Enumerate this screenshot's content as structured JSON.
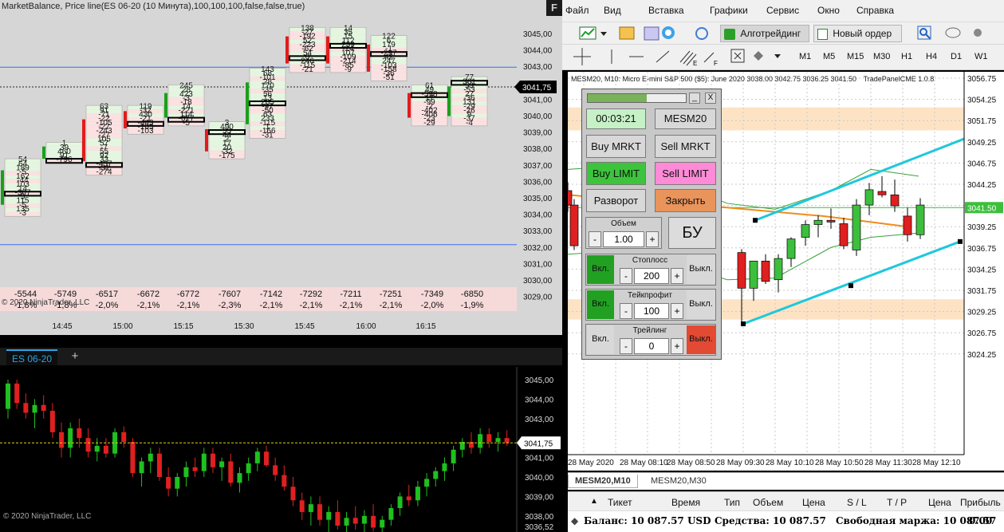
{
  "ninjatrader": {
    "chart_title": "MarketBalance, Price line(ES 06-20 (10 Минута),100,100,100,false,false,true)",
    "corner_label": "F",
    "copyright": "© 2020 NinjaTrader, LLC",
    "instrument_tab": "ES 06-20",
    "add_tab": "+",
    "price_axis_top": [
      "3045,00",
      "3044,00",
      "3043,00",
      "3042,00",
      "3041,00",
      "3040,00",
      "3039,00",
      "3038,00",
      "3037,00",
      "3036,00",
      "3035,00",
      "3034,00",
      "3033,00",
      "3032,00",
      "3031,00",
      "3030,00",
      "3029,00"
    ],
    "current_price": "3041,75",
    "time_labels": [
      "14:45",
      "15:00",
      "15:15",
      "15:30",
      "15:45",
      "16:00",
      "16:15"
    ],
    "deltas": [
      "-5544",
      "-5749",
      "-6517",
      "-6672",
      "-6772",
      "-7607",
      "-7142",
      "-7292",
      "-7211",
      "-7251",
      "-7349",
      "-6850"
    ],
    "delta_pct": [
      "-1,8%",
      "-1,8%",
      "-2,0%",
      "-2,1%",
      "-2,1%",
      "-2,3%",
      "-2,1%",
      "-2,1%",
      "-2,1%",
      "-2,1%",
      "-2,0%",
      "-1,9%"
    ],
    "price_axis_bottom": [
      "3045,00",
      "3044,00",
      "3043,00",
      "3042,00",
      "3041,00",
      "3040,00",
      "3039,00",
      "3038,00"
    ],
    "bottom_last_label": "3036,52"
  },
  "footprint_columns": [
    {
      "col": 0,
      "top_price": 3037.25,
      "values": [
        "54",
        "64",
        "189",
        "-5",
        "162",
        "-44",
        "103",
        "14",
        "-367",
        "5",
        "115",
        "-5",
        "135",
        "-3"
      ]
    },
    {
      "col": 1,
      "top_price": 3038.25,
      "values": [
        "1",
        "39",
        "460",
        "91",
        "-796"
      ]
    },
    {
      "col": 2,
      "top_price": 3040.5,
      "values": [
        "63",
        "91",
        "-71",
        "-22",
        "-105",
        "-27",
        "-243",
        "-27",
        "105",
        "57",
        "-7",
        "55",
        "92",
        "33",
        "-457",
        "-31",
        "-274"
      ]
    },
    {
      "col": 3,
      "top_price": 3040.5,
      "values": [
        "119",
        "-32",
        "430",
        "-21",
        "-443",
        "-105",
        "-103"
      ]
    },
    {
      "col": 4,
      "top_price": 3041.75,
      "values": [
        "245",
        "28",
        "423",
        "-3",
        "-18",
        "14",
        "-221",
        "114",
        "-677",
        "-5"
      ]
    },
    {
      "col": 5,
      "top_price": 3039.5,
      "values": [
        "3",
        "490",
        "53",
        "44",
        "2",
        "17",
        "20",
        "-32",
        "-175"
      ]
    },
    {
      "col": 6,
      "top_price": 3042.75,
      "values": [
        "143",
        "68",
        "-101",
        "28",
        "170",
        "-35",
        "56",
        "13",
        "285",
        "-97",
        "-50",
        "63",
        "233",
        "-115",
        "1",
        "-166",
        "-31"
      ]
    },
    {
      "col": 7,
      "top_price": 3045.25,
      "values": [
        "138",
        "-27",
        "-192",
        "52",
        "-223",
        "-62",
        "54",
        "0",
        "246",
        "-115",
        "-21"
      ]
    },
    {
      "col": 8,
      "top_price": 3045.25,
      "values": [
        "14",
        "35",
        "15",
        "112",
        "239",
        "-24",
        "107",
        "-109",
        "-214",
        "-85",
        "-9"
      ]
    },
    {
      "col": 9,
      "top_price": 3044.75,
      "values": [
        "122",
        "6",
        "179",
        "-1",
        "-297",
        "42",
        "247",
        "-103",
        "-158",
        "-36",
        "-51"
      ]
    },
    {
      "col": 10,
      "top_price": 3041.75,
      "values": [
        "61",
        "49",
        "-598",
        "17",
        "-99",
        "-2",
        "-402",
        "-406",
        "-23",
        "-29"
      ]
    },
    {
      "col": 11,
      "top_price": 3042.25,
      "values": [
        "77",
        "361",
        "53",
        "-53",
        "27",
        "-36",
        "131",
        "-29",
        "-26",
        "9",
        "-37",
        "-4"
      ]
    }
  ],
  "metatrader": {
    "menu": [
      "Файл",
      "Вид",
      "Вставка",
      "Графики",
      "Сервис",
      "Окно",
      "Справка"
    ],
    "algo_button": "Алготрейдинг",
    "new_order_button": "Новый ордер",
    "timeframes": [
      "M1",
      "M5",
      "M15",
      "M30",
      "H1",
      "H4",
      "D1",
      "W1"
    ],
    "chart_info": "MESM20, M10:  Micro E-mini S&P 500 ($5): June 2020  3038.00 3042.75 3036.25 3041.50",
    "indicator_label": "TradePanelCME 1.0.8",
    "price_axis": [
      "3056.75",
      "3054.25",
      "3051.75",
      "3049.25",
      "3046.75",
      "3044.25",
      "3041.50",
      "3039.25",
      "3036.75",
      "3034.25",
      "3031.75",
      "3029.25",
      "3026.75",
      "3024.25"
    ],
    "time_axis": [
      "28 May 2020",
      "28 May 08:10",
      "28 May 08:50",
      "28 May 09:30",
      "28 May 10:10",
      "28 May 10:50",
      "28 May 11:30",
      "28 May 12:10"
    ],
    "chart_tabs": [
      "MESM20,M10",
      "MESM20,M30"
    ],
    "trade_columns": [
      "Тикет",
      "Время",
      "Тип",
      "Объем",
      "Цена",
      "S / L",
      "T / P",
      "Цена",
      "Прибыль"
    ],
    "balance_text": "Баланс: 10 087.57 USD",
    "equity_text": "Средства: 10 087.57",
    "free_margin_text": "Свободная маржа: 10 087.57",
    "profit_value": "0.00"
  },
  "panel": {
    "timer": "00:03:21",
    "symbol": "MESM20",
    "buy_market": "Buy MRKT",
    "sell_market": "Sell MRKT",
    "buy_limit": "Buy LIMIT",
    "sell_limit": "Sell LIMIT",
    "reverse": "Разворот",
    "close": "Закрыть",
    "volume_label": "Объем",
    "volume_value": "1.00",
    "bu_button": "БУ",
    "on_label": "Вкл.",
    "off_label": "Выкл.",
    "stoploss_label": "Стоплосс",
    "stoploss_value": "200",
    "takeprofit_label": "Тейкпрофит",
    "takeprofit_value": "100",
    "trailing_label": "Трейлинг",
    "trailing_value": "0",
    "minus": "-",
    "plus": "+",
    "close_x": "X",
    "minimize": "_"
  },
  "colors": {
    "buy_green": "#2db52d",
    "sell_red": "#e02020",
    "panel_pink": "#ff8ad8",
    "panel_orange": "#e9945a",
    "off_red": "#e24a33",
    "cyan_line": "#1ec8dc"
  }
}
